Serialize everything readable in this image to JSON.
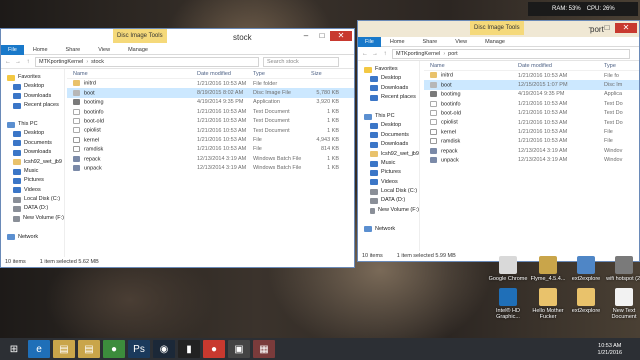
{
  "colors": {
    "ribbon_file": "#1979ca",
    "selection": "#cce8ff",
    "context_tab": "#f5d97a",
    "close": "#c8392f"
  },
  "gadget": {
    "ram": "RAM: 53%",
    "cpu": "CPU: 26%"
  },
  "left_window": {
    "context_tab": "Disc Image Tools",
    "title": "stock",
    "ribbon": [
      "File",
      "Home",
      "Share",
      "View",
      "Manage"
    ],
    "address": [
      "MTKportingKernel",
      "stock"
    ],
    "search_placeholder": "Search stock",
    "headers": {
      "name": "Name",
      "date": "Date modified",
      "type": "Type",
      "size": "Size"
    },
    "nav": [
      {
        "label": "Favorites",
        "icon": "star-icon"
      },
      {
        "label": "Desktop",
        "icon": "desktop-icon"
      },
      {
        "label": "Downloads",
        "icon": "downloads-icon"
      },
      {
        "label": "Recent places",
        "icon": "recent-places-icon"
      },
      {
        "label": "",
        "icon": ""
      },
      {
        "label": "This PC",
        "icon": "computer-icon"
      },
      {
        "label": "Desktop",
        "icon": "desktop-icon"
      },
      {
        "label": "Documents",
        "icon": "documents-icon"
      },
      {
        "label": "Downloads",
        "icon": "downloads-icon"
      },
      {
        "label": "lcsh92_wet_jb9",
        "icon": "folder-icon"
      },
      {
        "label": "Music",
        "icon": "music-icon"
      },
      {
        "label": "Pictures",
        "icon": "pictures-icon"
      },
      {
        "label": "Videos",
        "icon": "videos-icon"
      },
      {
        "label": "Local Disk (C:)",
        "icon": "drive-icon"
      },
      {
        "label": "DATA (D:)",
        "icon": "drive-icon"
      },
      {
        "label": "New Volume (F:)",
        "icon": "drive-icon"
      },
      {
        "label": "",
        "icon": ""
      },
      {
        "label": "Network",
        "icon": "network-icon"
      }
    ],
    "files": [
      {
        "name": "initrd",
        "date": "1/21/2016 10:53 AM",
        "type": "File folder",
        "size": "",
        "kind": "folder"
      },
      {
        "name": "boot",
        "date": "8/19/2015 8:02 AM",
        "type": "Disc Image File",
        "size": "5,780 KB",
        "kind": "disc"
      },
      {
        "name": "bootimg",
        "date": "4/19/2014 9:35 PM",
        "type": "Application",
        "size": "3,920 KB",
        "kind": "app"
      },
      {
        "name": "bootinfo",
        "date": "1/21/2016 10:53 AM",
        "type": "Text Document",
        "size": "1 KB",
        "kind": "txt"
      },
      {
        "name": "boot-old",
        "date": "1/21/2016 10:53 AM",
        "type": "Text Document",
        "size": "1 KB",
        "kind": "txt"
      },
      {
        "name": "cpiolist",
        "date": "1/21/2016 10:53 AM",
        "type": "Text Document",
        "size": "1 KB",
        "kind": "txt"
      },
      {
        "name": "kernel",
        "date": "1/21/2016 10:53 AM",
        "type": "File",
        "size": "4,943 KB",
        "kind": "file"
      },
      {
        "name": "ramdisk",
        "date": "1/21/2016 10:53 AM",
        "type": "File",
        "size": "814 KB",
        "kind": "file"
      },
      {
        "name": "repack",
        "date": "12/13/2014 3:19 AM",
        "type": "Windows Batch File",
        "size": "1 KB",
        "kind": "bat"
      },
      {
        "name": "unpack",
        "date": "12/13/2014 3:19 AM",
        "type": "Windows Batch File",
        "size": "1 KB",
        "kind": "bat"
      }
    ],
    "status": {
      "count": "10 items",
      "selected": "1 item selected  5.62 MB"
    }
  },
  "right_window": {
    "context_tab": "Disc Image Tools",
    "title": "port",
    "ribbon": [
      "File",
      "Home",
      "Share",
      "View",
      "Manage"
    ],
    "address": [
      "MTKportingKernel",
      "port"
    ],
    "headers": {
      "name": "Name",
      "date": "Date modified",
      "type": "Type"
    },
    "nav": [
      {
        "label": "Favorites",
        "icon": "star-icon"
      },
      {
        "label": "Desktop",
        "icon": "desktop-icon"
      },
      {
        "label": "Downloads",
        "icon": "downloads-icon"
      },
      {
        "label": "Recent places",
        "icon": "recent-places-icon"
      },
      {
        "label": "",
        "icon": ""
      },
      {
        "label": "This PC",
        "icon": "computer-icon"
      },
      {
        "label": "Desktop",
        "icon": "desktop-icon"
      },
      {
        "label": "Documents",
        "icon": "documents-icon"
      },
      {
        "label": "Downloads",
        "icon": "downloads-icon"
      },
      {
        "label": "lcsh92_wet_jb9",
        "icon": "folder-icon"
      },
      {
        "label": "Music",
        "icon": "music-icon"
      },
      {
        "label": "Pictures",
        "icon": "pictures-icon"
      },
      {
        "label": "Videos",
        "icon": "videos-icon"
      },
      {
        "label": "Local Disk (C:)",
        "icon": "drive-icon"
      },
      {
        "label": "DATA (D:)",
        "icon": "drive-icon"
      },
      {
        "label": "New Volume (F:)",
        "icon": "drive-icon"
      },
      {
        "label": "",
        "icon": ""
      },
      {
        "label": "Network",
        "icon": "network-icon"
      }
    ],
    "files": [
      {
        "name": "initrd",
        "date": "1/21/2016 10:53 AM",
        "type": "File fo",
        "kind": "folder"
      },
      {
        "name": "boot",
        "date": "12/15/2015 1:07 PM",
        "type": "Disc Im",
        "kind": "disc"
      },
      {
        "name": "bootimg",
        "date": "4/19/2014 9:35 PM",
        "type": "Applica",
        "kind": "app"
      },
      {
        "name": "bootinfo",
        "date": "1/21/2016 10:53 AM",
        "type": "Text Do",
        "kind": "txt"
      },
      {
        "name": "boot-old",
        "date": "1/21/2016 10:53 AM",
        "type": "Text Do",
        "kind": "txt"
      },
      {
        "name": "cpiolist",
        "date": "1/21/2016 10:53 AM",
        "type": "Text Do",
        "kind": "txt"
      },
      {
        "name": "kernel",
        "date": "1/21/2016 10:53 AM",
        "type": "File",
        "kind": "file"
      },
      {
        "name": "ramdisk",
        "date": "1/21/2016 10:53 AM",
        "type": "File",
        "kind": "file"
      },
      {
        "name": "repack",
        "date": "12/13/2014 3:19 AM",
        "type": "Windov",
        "kind": "bat"
      },
      {
        "name": "unpack",
        "date": "12/13/2014 3:19 AM",
        "type": "Windov",
        "kind": "bat"
      }
    ],
    "status": {
      "count": "10 items",
      "selected": "1 item selected  5.99 MB"
    }
  },
  "desktop_icons": [
    {
      "label": "Google Chrome",
      "icon": "chrome-icon",
      "color": "#d9d9d9"
    },
    {
      "label": "Flyme_4.5.4...",
      "icon": "archive-icon",
      "color": "#c9a54a"
    },
    {
      "label": "ext2explore",
      "icon": "app-icon",
      "color": "#4f86c6"
    },
    {
      "label": "wifi hotspot (2)",
      "icon": "wifi-icon",
      "color": "#7a7a7a"
    },
    {
      "label": "Intel® HD Graphic...",
      "icon": "intel-icon",
      "color": "#1f6fb8"
    },
    {
      "label": "Hello Mother Fucker",
      "icon": "folder-icon",
      "color": "#e9c26b"
    },
    {
      "label": "ext2explore",
      "icon": "folder-icon",
      "color": "#e9c26b"
    },
    {
      "label": "New Text Document",
      "icon": "text-file-icon",
      "color": "#f2f2f2"
    }
  ],
  "taskbar": [
    {
      "icon": "start-icon",
      "glyph": "⊞",
      "color": "#2c2f34"
    },
    {
      "icon": "ie-icon",
      "glyph": "e",
      "color": "#1f6fb8"
    },
    {
      "icon": "explorer-icon",
      "glyph": "▤",
      "color": "#c9a54a"
    },
    {
      "icon": "explorer-icon-2",
      "glyph": "▤",
      "color": "#c9a54a"
    },
    {
      "icon": "chrome-icon",
      "glyph": "●",
      "color": "#3c8c3c"
    },
    {
      "icon": "photoshop-icon",
      "glyph": "Ps",
      "color": "#1b3a5c"
    },
    {
      "icon": "steam-icon",
      "glyph": "◉",
      "color": "#1b2838"
    },
    {
      "icon": "terminal-icon",
      "glyph": "▮",
      "color": "#222"
    },
    {
      "icon": "record-icon",
      "glyph": "●",
      "color": "#c8392f"
    },
    {
      "icon": "app-icon",
      "glyph": "▣",
      "color": "#444"
    },
    {
      "icon": "flag-icon",
      "glyph": "▦",
      "color": "#7a3b3b"
    }
  ],
  "clock": {
    "time": "10:53 AM",
    "date": "1/21/2016"
  }
}
